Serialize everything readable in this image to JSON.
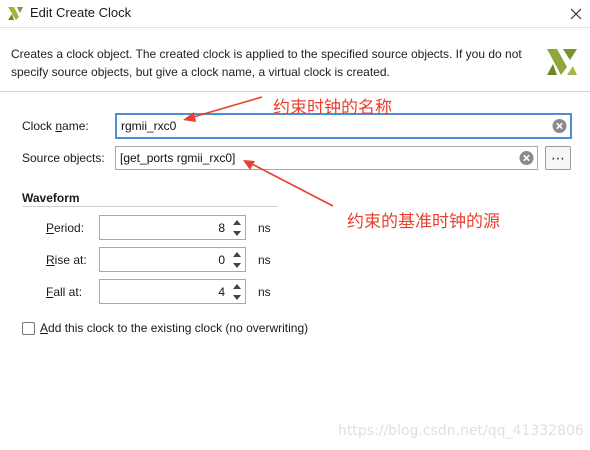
{
  "window": {
    "title": "Edit Create Clock",
    "close_icon": "close-icon",
    "app_icon": "vivado-logo-icon"
  },
  "info": {
    "text": "Creates a clock object. The created clock is applied to the specified source objects. If you do not specify source objects, but give a clock name, a virtual clock is created."
  },
  "form": {
    "clock_name": {
      "label_before": "Clock ",
      "label_mnemonic": "n",
      "label_after": "ame:",
      "value": "rgmii_rxc0"
    },
    "source_objects": {
      "label": "Source objects:",
      "value": "[get_ports rgmii_rxc0]",
      "browse_label": "⋯"
    }
  },
  "waveform": {
    "title": "Waveform",
    "period": {
      "mnemonic": "P",
      "label_rest": "eriod:",
      "value": "8",
      "unit": "ns"
    },
    "rise": {
      "mnemonic": "R",
      "label_rest": "ise at:",
      "value": "0",
      "unit": "ns"
    },
    "fall": {
      "mnemonic": "F",
      "label_rest": "all at:",
      "value": "4",
      "unit": "ns"
    }
  },
  "add_clock": {
    "label_mnemonic": "A",
    "label_rest": "dd this clock to the existing clock (no overwriting)",
    "checked": false
  },
  "annotations": {
    "clock_name_note": "约束时钟的名称",
    "source_note": "约束的基准时钟的源",
    "color": "#e8402e"
  },
  "watermark": "https://blog.csdn.net/qq_41332806",
  "colors": {
    "focus_border": "#4d8fd6",
    "logo_green": "#8ea63a"
  }
}
